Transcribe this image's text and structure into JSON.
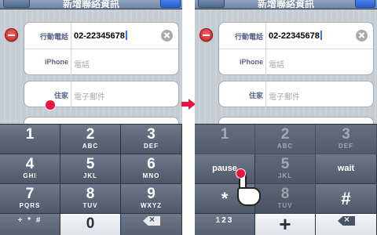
{
  "nav": {
    "title": "新增聯絡資訊"
  },
  "form": {
    "mobile_label": "行動電話",
    "mobile_value": "02-22345678",
    "iphone_label": "iPhone",
    "iphone_placeholder": "電話",
    "home_label": "住家",
    "email_placeholder": "電子郵件"
  },
  "keypad_left": {
    "keys": [
      {
        "digit": "1",
        "letters": ""
      },
      {
        "digit": "2",
        "letters": "ABC"
      },
      {
        "digit": "3",
        "letters": "DEF"
      },
      {
        "digit": "4",
        "letters": "GHI"
      },
      {
        "digit": "5",
        "letters": "JKL"
      },
      {
        "digit": "6",
        "letters": "MNO"
      },
      {
        "digit": "7",
        "letters": "PQRS"
      },
      {
        "digit": "8",
        "letters": "TUV"
      },
      {
        "digit": "9",
        "letters": "WXYZ"
      }
    ],
    "symbols_key": "+ * #",
    "zero_key": "0"
  },
  "keypad_right": {
    "keys": [
      {
        "digit": "1",
        "letters": ""
      },
      {
        "digit": "2",
        "letters": "ABC"
      },
      {
        "digit": "3",
        "letters": "DEF"
      },
      {
        "digit": "5",
        "letters": "JKL"
      },
      {
        "digit": "8",
        "letters": "TUV"
      }
    ],
    "pause": "pause",
    "wait": "wait",
    "star": "*",
    "hash": "#",
    "numbers_key": "123",
    "plus_key": "+"
  },
  "colors": {
    "highlight_red": "#e8163e",
    "nav_blue": "#6d84a3",
    "label_blue": "#526488"
  },
  "icons": [
    "delete-icon",
    "clear-icon",
    "backspace-icon",
    "arrow-right-icon",
    "hand-pointer-icon"
  ]
}
